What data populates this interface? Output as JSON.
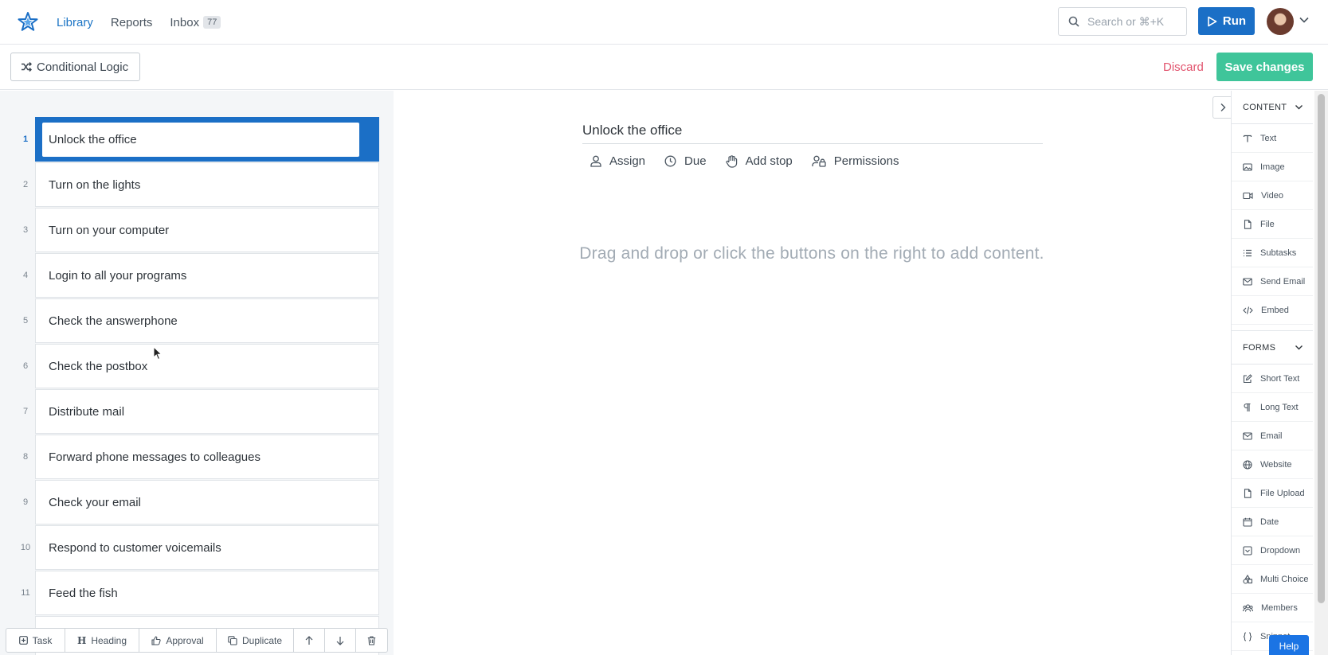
{
  "nav": {
    "items": [
      {
        "label": "Library",
        "active": true
      },
      {
        "label": "Reports",
        "active": false
      },
      {
        "label": "Inbox",
        "active": false,
        "badge": "77"
      }
    ],
    "search_placeholder": "Search or ⌘+K",
    "run_label": "Run"
  },
  "toolbar": {
    "conditional_logic_label": "Conditional Logic",
    "discard_label": "Discard",
    "save_label": "Save changes"
  },
  "tasks": [
    {
      "num": "1",
      "label": "Unlock the office",
      "selected": true
    },
    {
      "num": "2",
      "label": "Turn on the lights"
    },
    {
      "num": "3",
      "label": "Turn on your computer"
    },
    {
      "num": "4",
      "label": "Login to all your programs"
    },
    {
      "num": "5",
      "label": "Check the answerphone"
    },
    {
      "num": "6",
      "label": "Check the postbox"
    },
    {
      "num": "7",
      "label": "Distribute mail"
    },
    {
      "num": "8",
      "label": "Forward phone messages to colleagues"
    },
    {
      "num": "9",
      "label": "Check your email"
    },
    {
      "num": "10",
      "label": "Respond to customer voicemails"
    },
    {
      "num": "11",
      "label": "Feed the fish"
    },
    {
      "num": "",
      "label": ""
    }
  ],
  "bottom_bar": {
    "task": "Task",
    "heading": "Heading",
    "approval": "Approval",
    "duplicate": "Duplicate"
  },
  "step": {
    "title": "Unlock the office",
    "actions": {
      "assign": "Assign",
      "due": "Due",
      "add_stop": "Add stop",
      "permissions": "Permissions"
    },
    "dropzone": "Drag and drop or click the buttons on the right to add content."
  },
  "right_panel": {
    "content_header": "CONTENT",
    "content_items": [
      "Text",
      "Image",
      "Video",
      "File",
      "Subtasks",
      "Send Email",
      "Embed"
    ],
    "forms_header": "FORMS",
    "forms_items": [
      "Short Text",
      "Long Text",
      "Email",
      "Website",
      "File Upload",
      "Date",
      "Dropdown",
      "Multi Choice",
      "Members",
      "Snippet"
    ]
  },
  "help_label": "Help",
  "colors": {
    "accent": "#1b6fc6",
    "save": "#3fc59a",
    "discard": "#e2546e"
  }
}
